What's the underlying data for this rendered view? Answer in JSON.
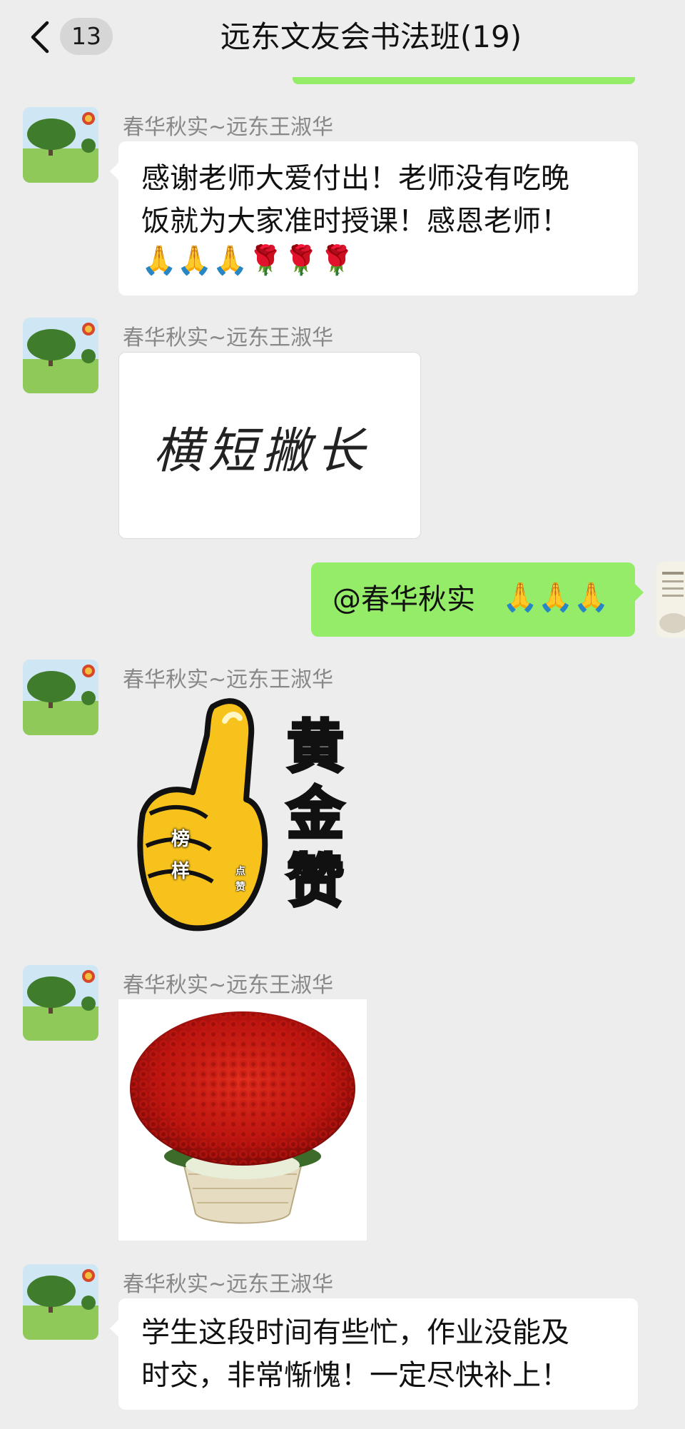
{
  "header": {
    "back_icon": "chevron-left-icon",
    "unread_count": "13",
    "title": "远东文友会书法班(19)"
  },
  "messages": [
    {
      "sender": "春华秋实~远东王淑华",
      "type": "text",
      "text": "感谢老师大爱付出！老师没有吃晚\n饭就为大家准时授课！感恩老师！",
      "emoji_row": "🙏🙏🙏🌹🌹🌹"
    },
    {
      "sender": "春华秋实~远东王淑华",
      "type": "image",
      "image_text": "横短撇长"
    },
    {
      "sender_self": true,
      "type": "text",
      "text": "@春华秋实 ",
      "emoji_row": "🙏🙏🙏"
    },
    {
      "sender": "春华秋实~远东王淑华",
      "type": "sticker",
      "sticker_main": [
        "黄",
        "金",
        "赞"
      ],
      "sticker_left": [
        "榜",
        "样"
      ],
      "sticker_small": [
        "点",
        "赞"
      ]
    },
    {
      "sender": "春华秋实~远东王淑华",
      "type": "image",
      "image_desc": "rose-bouquet"
    },
    {
      "sender": "春华秋实~远东王淑华",
      "type": "text",
      "text": "学生这段时间有些忙，作业没能及\n时交，非常惭愧！一定尽快补上！"
    }
  ],
  "colors": {
    "background": "#ededed",
    "self_bubble": "#95ec69",
    "other_bubble": "#ffffff"
  }
}
